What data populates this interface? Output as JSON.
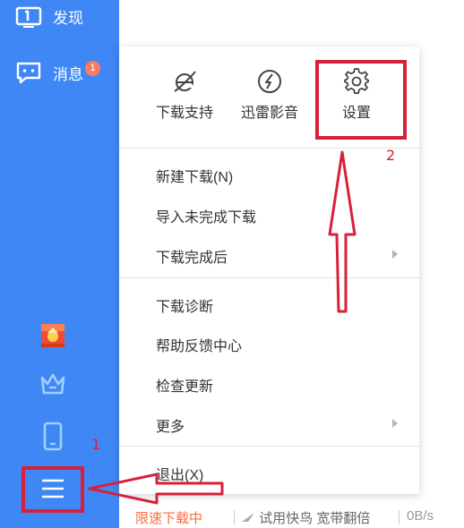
{
  "sidebar": {
    "discover_label": "发现",
    "messages_label": "消息",
    "messages_badge": "1"
  },
  "menu": {
    "top": {
      "download_support": "下载支持",
      "xunlei_player": "迅雷影音",
      "settings": "设置"
    },
    "items": [
      {
        "label": "新建下载(N)"
      },
      {
        "label": "导入未完成下载"
      },
      {
        "label": "下载完成后"
      },
      {
        "label": "下载诊断"
      },
      {
        "label": "帮助反馈中心"
      },
      {
        "label": "检查更新"
      },
      {
        "label": "更多"
      },
      {
        "label": "退出(X)"
      }
    ]
  },
  "status_bar": {
    "limit_text": "限速下载中",
    "trial_text": "试用快鸟 宽带翻倍",
    "speed": "0B/s"
  },
  "annotations": {
    "step1": "1",
    "step2": "2",
    "color": "#d8203a"
  },
  "colors": {
    "sidebar": "#3f87f5",
    "badge": "#ff7a5c",
    "limit_text": "#ff6a3d"
  }
}
